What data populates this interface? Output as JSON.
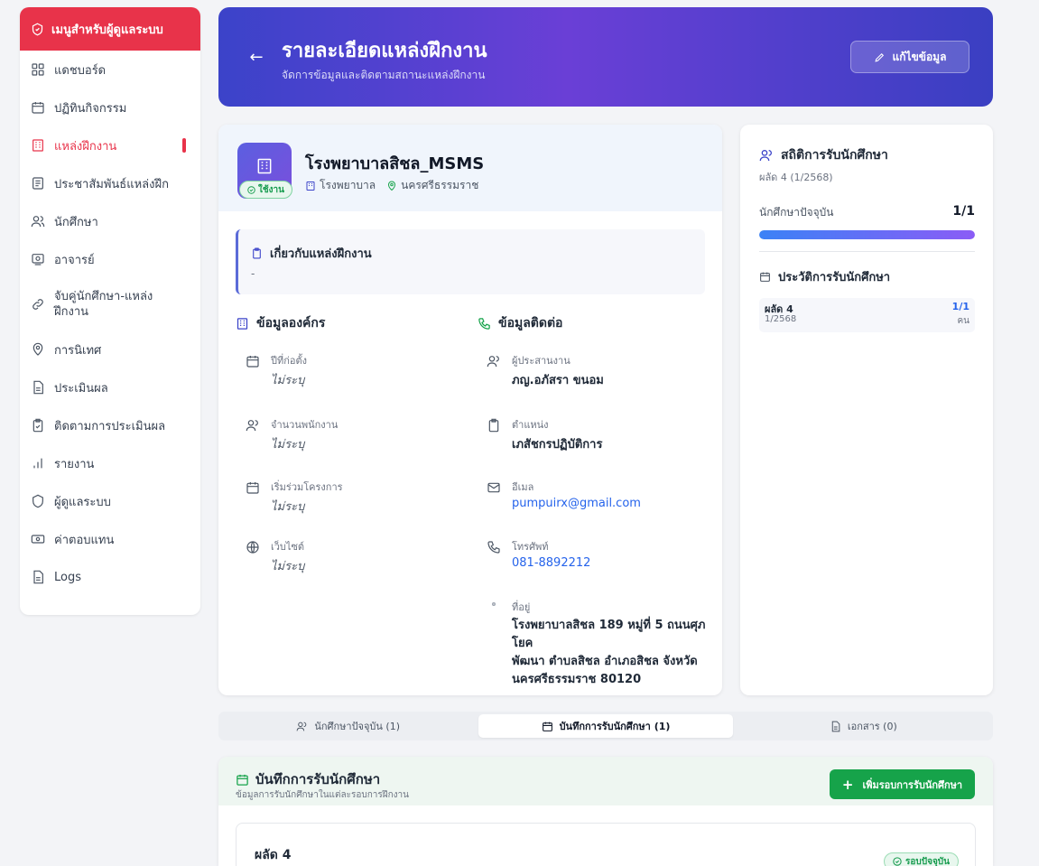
{
  "sidebar": {
    "title": "เมนูสำหรับผู้ดูแลระบบ",
    "items": [
      {
        "label": "แดชบอร์ด"
      },
      {
        "label": "ปฏิทินกิจกรรม"
      },
      {
        "label": "แหล่งฝึกงาน"
      },
      {
        "label": "ประชาสัมพันธ์แหล่งฝึก"
      },
      {
        "label": "นักศึกษา"
      },
      {
        "label": "อาจารย์"
      },
      {
        "label": "จับคู่นักศึกษา-แหล่ง ฝึกงาน"
      },
      {
        "label": "การนิเทศ"
      },
      {
        "label": "ประเมินผล"
      },
      {
        "label": "ติดตามการประเมินผล"
      },
      {
        "label": "รายงาน"
      },
      {
        "label": "ผู้ดูแลระบบ"
      },
      {
        "label": "ค่าตอบแทน"
      },
      {
        "label": "Logs"
      }
    ]
  },
  "header": {
    "back": "←",
    "title": "รายละเอียดแหล่งฝึกงาน",
    "subtitle": "จัดการข้อมูลและติดตามสถานะแหล่งฝึกงาน",
    "edit_label": "แก้ไขข้อมูล"
  },
  "org": {
    "name": "โรงพยาบาลสิชล_MSMS",
    "status": "ใช้งาน",
    "type": "โรงพยาบาล",
    "province": "นครศรีธรรมราช",
    "about_title": "เกี่ยวกับแหล่งฝึกงาน",
    "about_body": "-"
  },
  "org_info": {
    "title": "ข้อมูลองค์กร",
    "fields": [
      {
        "label": "ปีที่ก่อตั้ง",
        "value": "ไม่ระบุ"
      },
      {
        "label": "จำนวนพนักงาน",
        "value": "ไม่ระบุ"
      },
      {
        "label": "เริ่มร่วมโครงการ",
        "value": "ไม่ระบุ"
      },
      {
        "label": "เว็บไซต์",
        "value": "ไม่ระบุ"
      }
    ]
  },
  "contact": {
    "title": "ข้อมูลติดต่อ",
    "coordinator_label": "ผู้ประสานงาน",
    "coordinator": "ภญ.อภัสรา ขนอม",
    "position_label": "ตำแหน่ง",
    "position": "เภสัชกรปฏิบัติการ",
    "email_label": "อีเมล",
    "email": "pumpuirx@gmail.com",
    "phone_label": "โทรศัพท์",
    "phone": "081-8892212",
    "address_label": "ที่อยู่",
    "address_1": "โรงพยาบาลสิชล 189 หมู่ที่ 5 ถนนศุภโยค",
    "address_2": "พัฒนา ตำบลสิชล อำเภอสิชล จังหวัด",
    "address_3": "นครศรีธรรมราช 80120"
  },
  "stats": {
    "title": "สถิติการรับนักศึกษา",
    "subtitle": "ผลัด 4 (1/2568)",
    "current_label": "นักศึกษาปัจจุบัน",
    "current_value": "1/1",
    "progress": 1.0,
    "history_title": "ประวัติการรับนักศึกษา",
    "history": [
      {
        "name": "ผลัด 4",
        "sub": "1/2568",
        "value": "1/1",
        "unit": "คน"
      }
    ]
  },
  "tabs": [
    {
      "label": "นักศึกษาปัจจุบัน (1)"
    },
    {
      "label": "บันทึกการรับนักศึกษา (1)"
    },
    {
      "label": "เอกสาร (0)"
    }
  ],
  "records": {
    "title": "บันทึกการรับนักศึกษา",
    "subtitle": "ข้อมูลการรับนักศึกษาในแต่ละรอบการฝึกงาน",
    "add_label": "เพิ่มรอบการรับนักศึกษา",
    "add_icon": "+",
    "item_name": "ผลัด 4",
    "item_badge": "รอบปัจจุบัน"
  },
  "colors": {
    "accent": "#e8334a",
    "primary": "#3b43c9",
    "success": "#16a34a"
  }
}
